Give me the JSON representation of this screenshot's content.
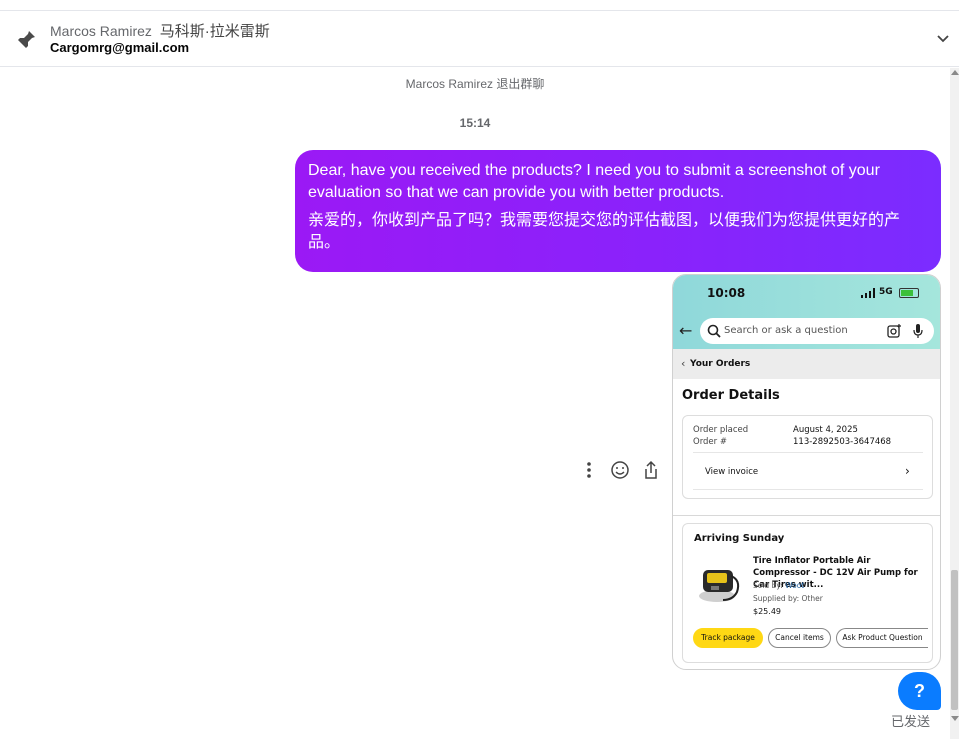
{
  "header": {
    "name": "Marcos Ramirez",
    "name_cn": "马科斯·拉米雷斯",
    "email": "Cargomrg@gmail.com"
  },
  "chat": {
    "system_message": "Marcos Ramirez 退出群聊",
    "timestamp": "15:14",
    "message_en": "Dear, have you received the products? I need you to submit a screenshot of your evaluation so that we can provide you with better products.",
    "message_cn": "亲爱的，你收到产品了吗？我需要您提交您的评估截图，以便我们为您提供更好的产品。",
    "bubble_gradient": [
      "#9b19f5",
      "#7b2cff"
    ],
    "status": "已发送",
    "help_label": "?"
  },
  "screenshot": {
    "status_time": "10:08",
    "network": "5G",
    "search_placeholder": "Search or ask a question",
    "breadcrumb": "Your Orders",
    "order_details_title": "Order Details",
    "order_placed_label": "Order placed",
    "order_placed_value": "August 4, 2025",
    "order_num_label": "Order #",
    "order_num_value": "113-2892503-3647468",
    "view_invoice": "View invoice",
    "arriving": "Arriving Sunday",
    "product_name": "Tire Inflator Portable Air Compressor - DC 12V Air Pump for Car Tires wit...",
    "sold_by_label": "Sold by: ",
    "seller": "Woot",
    "supplied_by": "Supplied by: Other",
    "price": "$25.49",
    "btn_track": "Track package",
    "btn_cancel": "Cancel items",
    "btn_ask": "Ask Product Question"
  },
  "colors": {
    "accent_blue": "#0a7cff",
    "track_yellow": "#ffd814",
    "screenshot_header": "#a5e6dc"
  }
}
